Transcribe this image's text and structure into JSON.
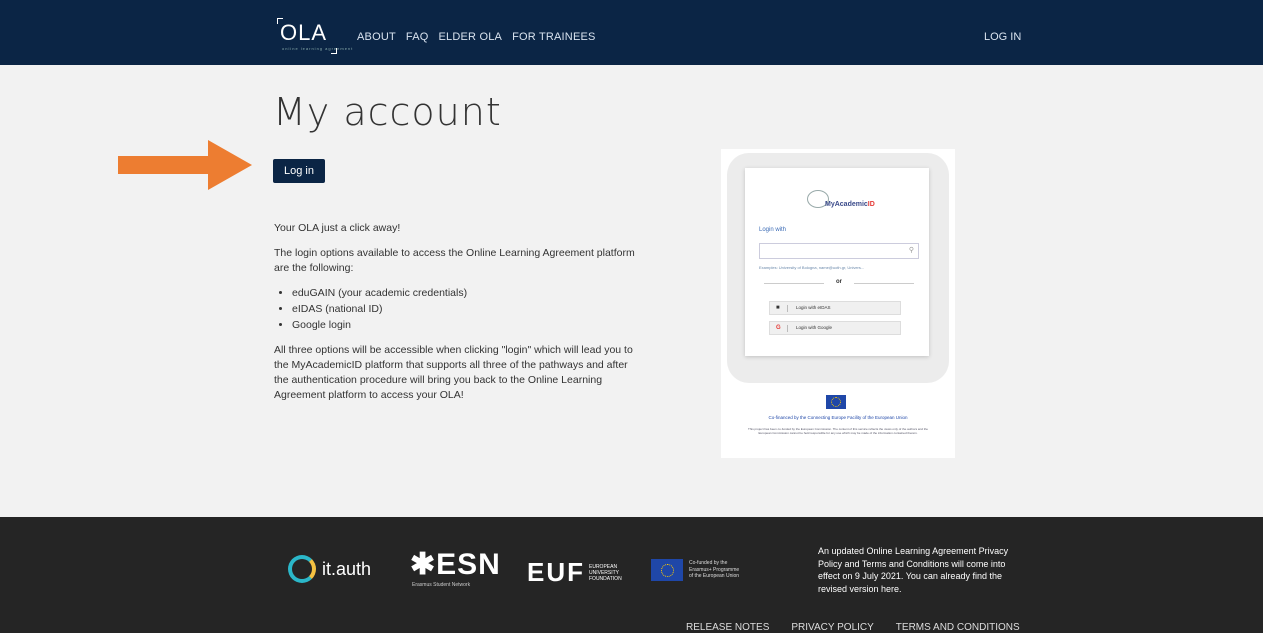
{
  "header": {
    "logo_text": "OLA",
    "logo_tagline": "online learning agreement",
    "nav": [
      "ABOUT",
      "FAQ",
      "ELDER OLA",
      "FOR TRAINEES"
    ],
    "login_link": "LOG IN"
  },
  "main": {
    "title": "My account",
    "login_button": "Log in",
    "intro": "Your OLA just a click away!",
    "options_intro": "The login options available to access the Online Learning Agreement platform are the following:",
    "options": [
      "eduGAIN (your academic credentials)",
      "eIDAS (national ID)",
      "Google login"
    ],
    "closing": "All three options will be accessible when clicking \"login\" which will lead you to the MyAcademicID platform that supports all three of the pathways and after the authentication procedure will bring you back to the Online Learning Agreement platform to access your OLA!"
  },
  "preview": {
    "brand_main": "MyAcademic",
    "brand_accent": "ID",
    "login_with": "Login with",
    "example": "Examples: University of Bologna, name@uoth.gr, Univers...",
    "or": "or",
    "eidas_label": "Login with eIDAS",
    "google_label": "Login with Google",
    "cofinanced": "Co-financed by the Connecting Europe Facility of the European Union",
    "disclaimer": "This project has been co-funded by the European Commission. The content of this service reflects the views only of the authors and the European Commission cannot be held responsible for any use which may be made of the information contained therein."
  },
  "footer": {
    "ithauth": "it.auth",
    "esn": "ESN",
    "esn_sub": "Erasmus Student Network",
    "euf": "EUF",
    "euf_sub": [
      "EUROPEAN",
      "UNIVERSITY",
      "FOUNDATION"
    ],
    "erasmus_lines": [
      "Co-funded by the",
      "Erasmus+ Programme",
      "of the European Union"
    ],
    "notice": "An updated Online Learning Agreement Privacy Policy and Terms and Conditions will come into effect on 9 July 2021. You can already find the revised version here.",
    "links": [
      "RELEASE NOTES",
      "PRIVACY POLICY",
      "TERMS AND CONDITIONS"
    ]
  },
  "colors": {
    "navy": "#0b2545",
    "arrow": "#ed7d31",
    "footer_bg": "#252525"
  }
}
